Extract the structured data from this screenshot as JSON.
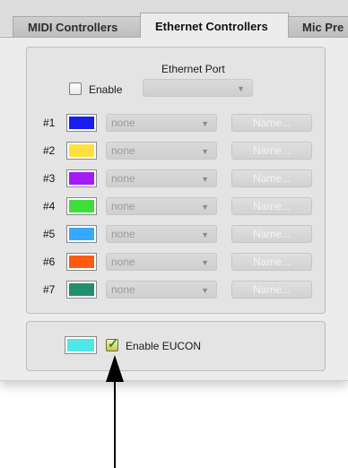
{
  "tabs": [
    {
      "label": "MIDI Controllers",
      "active": false
    },
    {
      "label": "Ethernet Controllers",
      "active": true
    },
    {
      "label": "Mic Pre",
      "active": false
    }
  ],
  "ethernet": {
    "port_label": "Ethernet Port",
    "enable_label": "Enable",
    "port_value": ""
  },
  "controllers": [
    {
      "num": "#1",
      "color": "#1a1df0",
      "value": "none",
      "name_label": "Name..."
    },
    {
      "num": "#2",
      "color": "#ffe040",
      "value": "none",
      "name_label": "Name..."
    },
    {
      "num": "#3",
      "color": "#a31cf5",
      "value": "none",
      "name_label": "Name..."
    },
    {
      "num": "#4",
      "color": "#3dde3a",
      "value": "none",
      "name_label": "Name..."
    },
    {
      "num": "#5",
      "color": "#36a9ff",
      "value": "none",
      "name_label": "Name..."
    },
    {
      "num": "#6",
      "color": "#ff5a12",
      "value": "none",
      "name_label": "Name..."
    },
    {
      "num": "#7",
      "color": "#1f8f6d",
      "value": "none",
      "name_label": "Name..."
    }
  ],
  "eucon": {
    "label": "Enable EUCON",
    "checked": true,
    "swatch_color": "#4fe6e6"
  }
}
